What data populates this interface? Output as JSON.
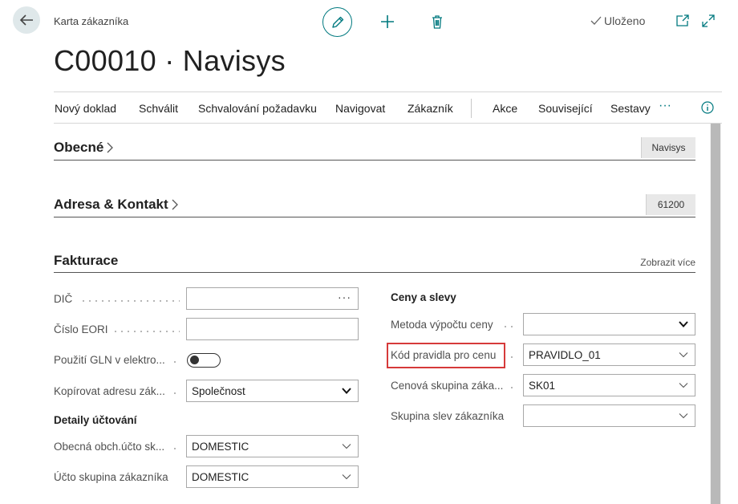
{
  "header": {
    "breadcrumb": "Karta zákazníka",
    "title": "C00010 · Navisys",
    "saved_label": "Uloženo"
  },
  "action_bar": {
    "items": [
      "Nový doklad",
      "Schválit",
      "Schvalování požadavku",
      "Navigovat",
      "Zákazník",
      "Akce",
      "Související",
      "Sestavy"
    ],
    "more": "···"
  },
  "sections": {
    "general": {
      "title": "Obecné",
      "summary": "Navisys"
    },
    "address": {
      "title": "Adresa & Kontakt",
      "summary": "61200"
    },
    "invoicing": {
      "title": "Fakturace",
      "show_more": "Zobrazit více"
    }
  },
  "invoicing": {
    "vat_label": "DIČ",
    "vat_value": "",
    "vat_ellipsis": "···",
    "eori_label": "Číslo EORI",
    "eori_value": "",
    "gln_label": "Použití GLN v elektro...",
    "gln_enabled": false,
    "copy_address_label": "Kopírovat adresu zák...",
    "copy_address_value": "Společnost",
    "posting_heading": "Detaily účtování",
    "gen_bus_label": "Obecná obch.účto sk...",
    "gen_bus_value": "DOMESTIC",
    "cust_posting_label": "Účto skupina zákazníka",
    "cust_posting_value": "DOMESTIC",
    "prices_heading": "Ceny a slevy",
    "price_method_label": "Metoda výpočtu ceny",
    "price_method_value": "",
    "price_rule_label": "Kód pravidla pro cenu",
    "price_rule_value": "PRAVIDLO_01",
    "price_group_label": "Cenová skupina záka...",
    "price_group_value": "SK01",
    "disc_group_label": "Skupina slev zákazníka",
    "disc_group_value": ""
  },
  "colors": {
    "accent": "#00797f",
    "highlight": "#d63a3a"
  },
  "icons": [
    "back-arrow-icon",
    "edit-pencil-icon",
    "plus-icon",
    "trash-icon",
    "checkmark-icon",
    "open-new-window-icon",
    "expand-icon",
    "info-icon",
    "chevron-right-icon",
    "chevron-down-icon"
  ]
}
